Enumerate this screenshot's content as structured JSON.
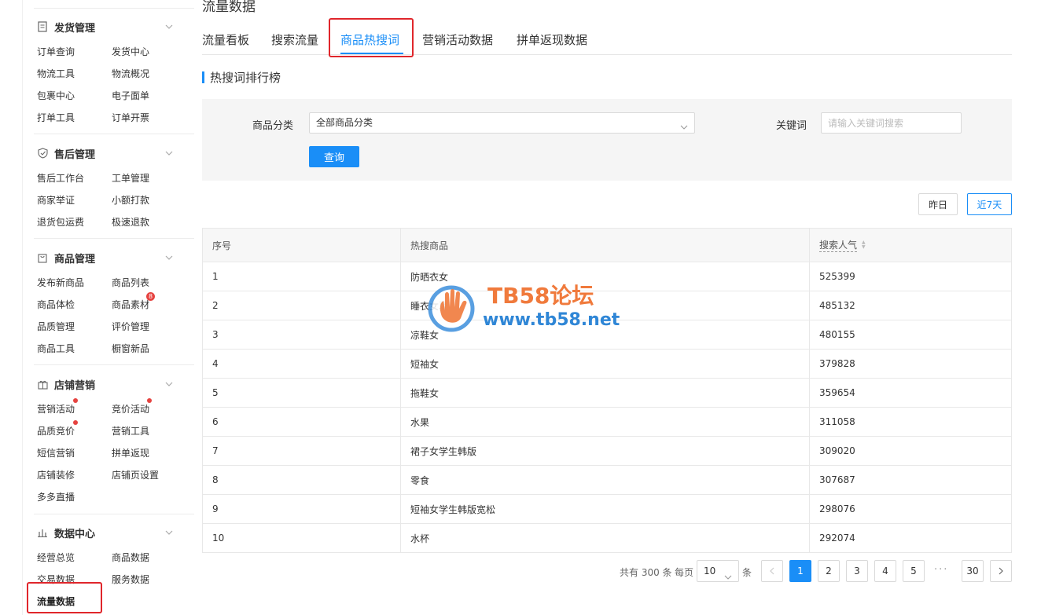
{
  "sidebar": {
    "sections": [
      {
        "title": "发货管理",
        "icon": "document-icon",
        "items": [
          "订单查询",
          "发货中心",
          "物流工具",
          "物流概况",
          "包裹中心",
          "电子面单",
          "打单工具",
          "订单开票"
        ]
      },
      {
        "title": "售后管理",
        "icon": "shield-check-icon",
        "items": [
          "售后工作台",
          "工单管理",
          "商家举证",
          "小额打款",
          "退货包运费",
          "极速退款"
        ]
      },
      {
        "title": "商品管理",
        "icon": "bag-icon",
        "items": [
          "发布新商品",
          "商品列表",
          "商品体检",
          "商品素材",
          "品质管理",
          "评价管理",
          "商品工具",
          "橱窗新品"
        ],
        "badge": "8"
      },
      {
        "title": "店铺营销",
        "icon": "gift-icon",
        "items": [
          "营销活动",
          "竞价活动",
          "品质竞价",
          "营销工具",
          "短信营销",
          "拼单返现",
          "店铺装修",
          "店铺页设置",
          "多多直播"
        ]
      },
      {
        "title": "数据中心",
        "icon": "bar-chart-icon",
        "items": [
          "经营总览",
          "商品数据",
          "交易数据",
          "服务数据",
          "流量数据"
        ]
      }
    ]
  },
  "page": {
    "title": "流量数据",
    "tabs": [
      "流量看板",
      "搜索流量",
      "商品热搜词",
      "营销活动数据",
      "拼单返现数据"
    ],
    "active_tab": "商品热搜词",
    "section_title": "热搜词排行榜"
  },
  "filter": {
    "category_label": "商品分类",
    "category_value": "全部商品分类",
    "keyword_label": "关键词",
    "keyword_placeholder": "请输入关键词搜索",
    "query_button": "查询"
  },
  "range": {
    "yesterday": "昨日",
    "last7": "近7天",
    "active": "近7天"
  },
  "table": {
    "columns": [
      "序号",
      "热搜商品",
      "搜索人气"
    ],
    "rows": [
      {
        "rank": "1",
        "product": "防晒衣女",
        "popularity": "525399"
      },
      {
        "rank": "2",
        "product": "睡衣女夏",
        "popularity": "485132"
      },
      {
        "rank": "3",
        "product": "凉鞋女",
        "popularity": "480155"
      },
      {
        "rank": "4",
        "product": "短袖女",
        "popularity": "379828"
      },
      {
        "rank": "5",
        "product": "拖鞋女",
        "popularity": "359654"
      },
      {
        "rank": "6",
        "product": "水果",
        "popularity": "311058"
      },
      {
        "rank": "7",
        "product": "裙子女学生韩版",
        "popularity": "309020"
      },
      {
        "rank": "8",
        "product": "零食",
        "popularity": "307687"
      },
      {
        "rank": "9",
        "product": "短袖女学生韩版宽松",
        "popularity": "298076"
      },
      {
        "rank": "10",
        "product": "水杯",
        "popularity": "292074"
      }
    ]
  },
  "pagination": {
    "total_text": "共有 300 条",
    "per_page_label": "每页",
    "per_page_value": "10",
    "unit": "条",
    "pages": [
      "1",
      "2",
      "3",
      "4",
      "5"
    ],
    "ellipsis": "···",
    "last_page": "30",
    "current": "1"
  },
  "watermark": {
    "title": "TB58论坛",
    "url": "www.tb58.net"
  },
  "colors": {
    "accent": "#1a8ef7",
    "highlight_box": "#e0262b",
    "dot": "#e64340"
  }
}
